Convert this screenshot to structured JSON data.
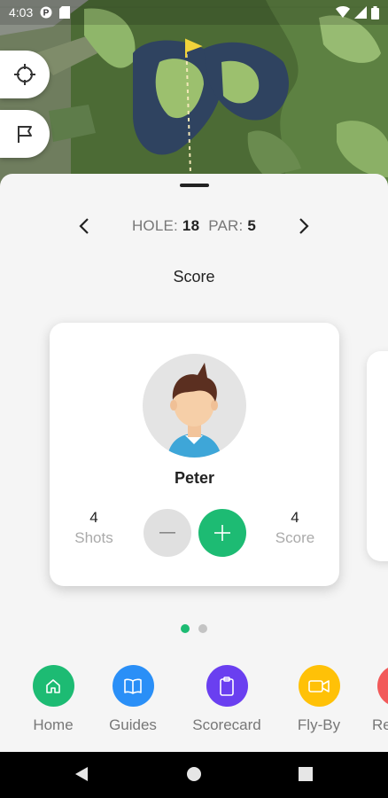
{
  "status_bar": {
    "time": "4:03"
  },
  "map": {
    "target_button_icon": "crosshair-icon",
    "flag_button_icon": "flag-icon"
  },
  "hole": {
    "hole_label": "HOLE:",
    "hole_number": "18",
    "par_label": "PAR:",
    "par_value": "5"
  },
  "section_title": "Score",
  "player": {
    "name": "Peter",
    "shots_value": "4",
    "shots_label": "Shots",
    "score_value": "4",
    "score_label": "Score"
  },
  "pagination": {
    "total": 2,
    "active": 1
  },
  "colors": {
    "accent": "#1dbb73",
    "home": "#1dbb73",
    "guides": "#2a8ff7",
    "scorecard": "#6a3ff0",
    "flyby": "#ffc107",
    "results": "#f25a5a"
  },
  "nav": [
    {
      "label": "Home",
      "icon": "home-icon"
    },
    {
      "label": "Guides",
      "icon": "book-icon"
    },
    {
      "label": "Scorecard",
      "icon": "clipboard-icon"
    },
    {
      "label": "Fly-By",
      "icon": "video-icon"
    },
    {
      "label": "Re",
      "icon": "results-icon"
    }
  ]
}
